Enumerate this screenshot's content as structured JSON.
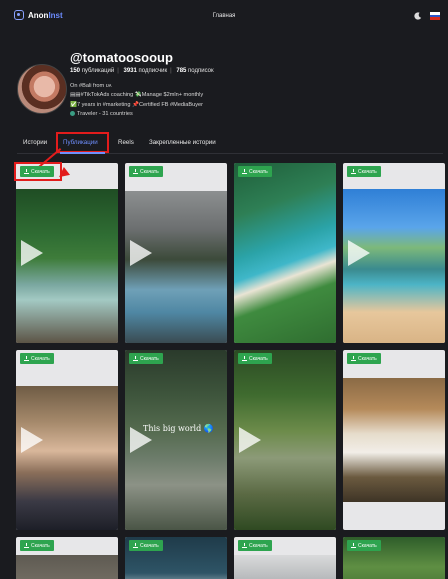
{
  "header": {
    "brand_prefix": "Anon",
    "brand_accent": "Inst",
    "nav_home": "Главная",
    "theme_icon": "moon-icon",
    "language_icon": "flag-ru-icon"
  },
  "profile": {
    "username": "@tomatoosooup",
    "posts_count": "150",
    "posts_label": "публикаций",
    "followers_count": "3931",
    "followers_label": "подписчик",
    "following_count": "785",
    "following_label": "подписок",
    "bio_line1": "On #Bali from ᴜᴀ",
    "bio_line2": "▤▤#TikTokAds coaching 💸Manage $2mln+ monthly",
    "bio_line3": "✅7 years in #marketing 📌Certified FB #MediaBuyer",
    "bio_line4": "Traveler - 31 countries"
  },
  "tabs": [
    {
      "label": "Истории",
      "active": false
    },
    {
      "label": "Публикации",
      "active": true
    },
    {
      "label": "Reels",
      "active": false
    },
    {
      "label": "Закрепленные истории",
      "active": false
    }
  ],
  "download_label": "Скачать",
  "posts": [
    {
      "is_video": true,
      "caption": ""
    },
    {
      "is_video": true,
      "caption": ""
    },
    {
      "is_video": false,
      "caption": ""
    },
    {
      "is_video": true,
      "caption": ""
    },
    {
      "is_video": true,
      "caption": ""
    },
    {
      "is_video": true,
      "caption": "This big world 🌎"
    },
    {
      "is_video": true,
      "caption": ""
    },
    {
      "is_video": false,
      "caption": ""
    },
    {
      "is_video": false,
      "caption": ""
    },
    {
      "is_video": false,
      "caption": ""
    },
    {
      "is_video": false,
      "caption": ""
    },
    {
      "is_video": false,
      "caption": ""
    }
  ],
  "colors": {
    "background": "#1a1b1f",
    "accent": "#6f8fff",
    "download_button": "#2ea44f",
    "highlight": "#e21c1c"
  }
}
